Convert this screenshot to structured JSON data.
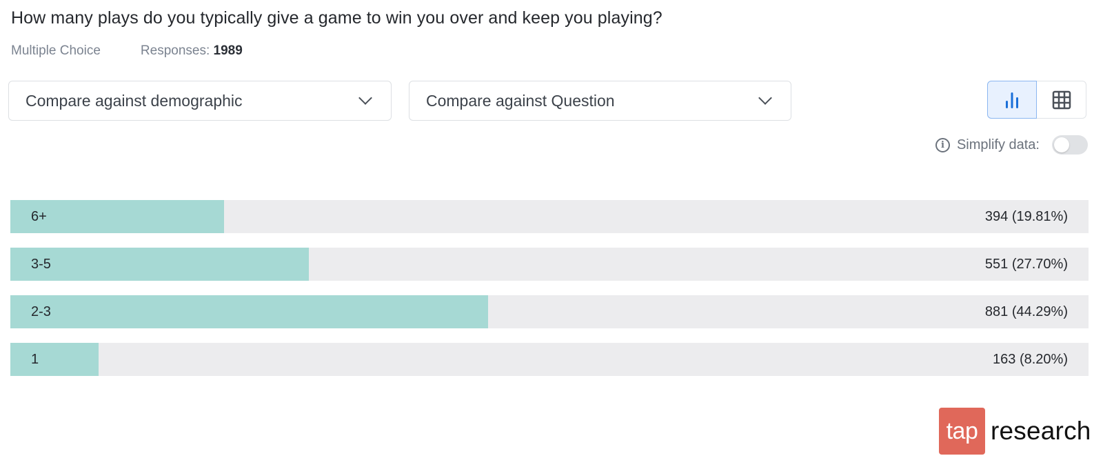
{
  "question": {
    "title": "How many plays do you typically give a game to win you over and keep you playing?",
    "type": "Multiple Choice",
    "responses_label": "Responses:",
    "responses_count": "1989"
  },
  "controls": {
    "demographic_dropdown": "Compare against demographic",
    "question_dropdown": "Compare against Question",
    "view_modes": [
      {
        "name": "bar-chart",
        "icon": "bar-chart-icon",
        "active": true
      },
      {
        "name": "table",
        "icon": "grid-table-icon",
        "active": false
      }
    ],
    "simplify_label": "Simplify data:",
    "simplify_on": false
  },
  "colors": {
    "bar_fill": "#a6d9d4",
    "bar_track": "#ececee",
    "active_view": "#1a6fd8",
    "logo_brand": "#e0685a"
  },
  "chart_data": {
    "type": "bar",
    "orientation": "horizontal",
    "categories": [
      "6+",
      "3-5",
      "2-3",
      "1"
    ],
    "values": [
      394,
      551,
      881,
      163
    ],
    "percentages": [
      19.81,
      27.7,
      44.29,
      8.2
    ],
    "value_labels": [
      "394 (19.81%)",
      "551 (27.70%)",
      "881 (44.29%)",
      "163 (8.20%)"
    ],
    "total": 1989,
    "xlim": [
      0,
      44.29
    ],
    "title": "",
    "xlabel": "",
    "ylabel": ""
  },
  "logo": {
    "box_text": "tap",
    "text": "research"
  }
}
